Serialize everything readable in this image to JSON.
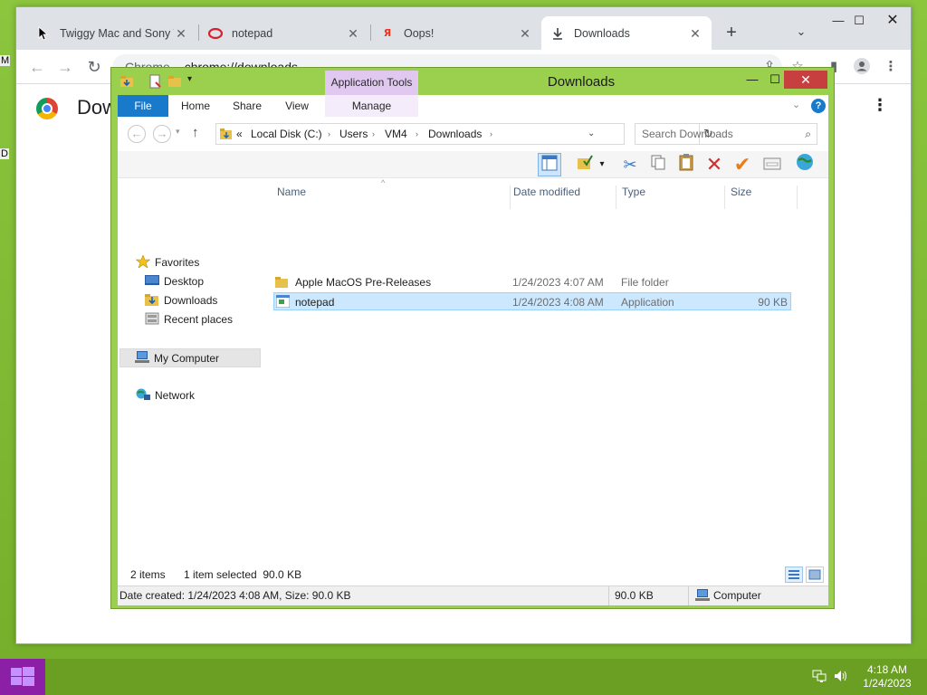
{
  "browser": {
    "tabs": [
      {
        "title": "Twiggy Mac and Sony T",
        "icon": "document-icon"
      },
      {
        "title": "notepad",
        "icon": "opera-icon"
      },
      {
        "title": "Oops!",
        "icon": "yandex-icon"
      },
      {
        "title": "Downloads",
        "icon": "download-icon"
      }
    ],
    "omnibox": {
      "site": "Chrome",
      "url": "chrome://downloads"
    },
    "page_title": "Downloads"
  },
  "explorer": {
    "title": "Downloads",
    "contextual_tab": "Application Tools",
    "ribbon_tabs": [
      "File",
      "Home",
      "Share",
      "View",
      "Manage"
    ],
    "breadcrumb": {
      "overflow": "«",
      "parts": [
        "Local Disk (C:)",
        "Users",
        "VM4",
        "Downloads"
      ]
    },
    "search_placeholder": "Search Downloads",
    "nav": {
      "favorites": "Favorites",
      "desktop": "Desktop",
      "downloads": "Downloads",
      "recent": "Recent places",
      "computer": "My Computer",
      "network": "Network"
    },
    "columns": [
      "Name",
      "Date modified",
      "Type",
      "Size"
    ],
    "files": [
      {
        "name": "Apple MacOS Pre-Releases",
        "date": "1/24/2023 4:07 AM",
        "type": "File folder",
        "size": "",
        "icon": "folder-icon",
        "selected": false
      },
      {
        "name": "notepad",
        "date": "1/24/2023 4:08 AM",
        "type": "Application",
        "size": "90 KB",
        "icon": "application-icon",
        "selected": true
      }
    ],
    "status": {
      "count": "2 items",
      "selection": "1 item selected  90.0 KB"
    },
    "details": {
      "info": "Date created: 1/24/2023 4:08 AM, Size: 90.0 KB",
      "size": "90.0 KB",
      "location": "Computer"
    }
  },
  "taskbar": {
    "time": "4:18 AM",
    "date": "1/24/2023"
  },
  "colors": {
    "desktop": "#8cc63f",
    "file_tab": "#1979ca",
    "app_tools": "#e0c8f0",
    "close": "#c7403f",
    "start": "#8b1fa6"
  }
}
